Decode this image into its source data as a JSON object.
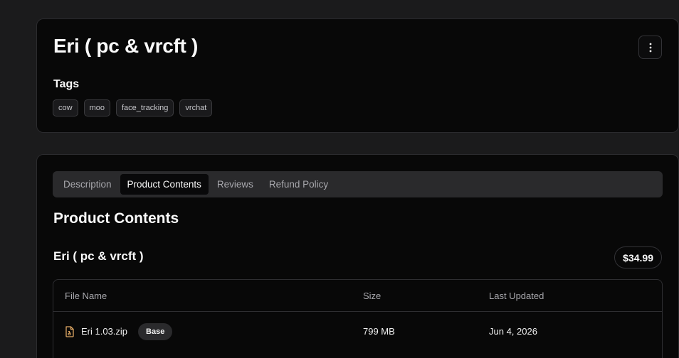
{
  "product": {
    "title": "Eri ( pc & vrcft )",
    "tags_heading": "Tags",
    "tags": [
      "cow",
      "moo",
      "face_tracking",
      "vrchat"
    ]
  },
  "tabs": [
    {
      "label": "Description",
      "active": false
    },
    {
      "label": "Product Contents",
      "active": true
    },
    {
      "label": "Reviews",
      "active": false
    },
    {
      "label": "Refund Policy",
      "active": false
    }
  ],
  "contents": {
    "heading": "Product Contents",
    "item_name": "Eri ( pc & vrcft )",
    "price": "$34.99",
    "columns": [
      "File Name",
      "Size",
      "Last Updated"
    ],
    "files": [
      {
        "name": "Eri 1.03.zip",
        "badge": "Base",
        "size": "799 MB",
        "updated": "Jun 4, 2026",
        "icon": "zip-file-icon"
      }
    ]
  },
  "colors": {
    "background": "#1b1b1c",
    "card": "#080808",
    "file_icon": "#e0a864"
  }
}
